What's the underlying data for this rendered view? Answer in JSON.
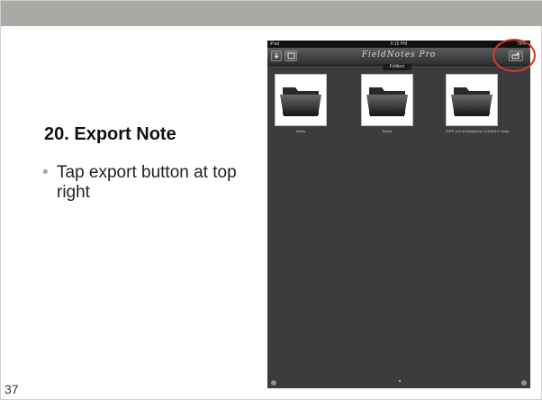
{
  "slide": {
    "title": "20. Export Note",
    "bullet": "Tap export button at top right",
    "bullet_marker": "•",
    "page_number": "37"
  },
  "ipad": {
    "status": {
      "carrier": "iPad",
      "time": "6:15 PM",
      "battery": "79%"
    },
    "toolbar": {
      "title": "FieldNotes Pro",
      "left_button_1_icon": "down-arrow-icon",
      "left_button_2_icon": "window-icon",
      "export_button_icon": "export-icon"
    },
    "segment_label": "Folders",
    "folders": [
      {
        "label": "Notes"
      },
      {
        "label": "Demo"
      },
      {
        "label": "ISPR UCLA Workshop 1/16/2013. Unity"
      }
    ]
  },
  "colors": {
    "band": "#a8aaa6",
    "highlight": "#d33a24",
    "ipad_bg": "#3b3c3e"
  }
}
